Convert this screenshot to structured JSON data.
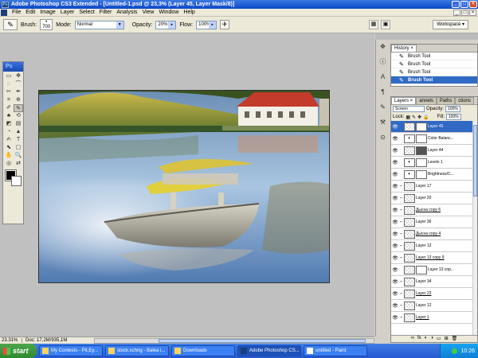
{
  "window": {
    "title": "Adobe Photoshop CS3 Extended - [Untitled-1.psd @ 23,3% (Layer 45, Layer Mask/8)]",
    "buttons": [
      "_",
      "□",
      "×"
    ]
  },
  "menu": [
    "File",
    "Edit",
    "Image",
    "Layer",
    "Select",
    "Filter",
    "Analysis",
    "View",
    "Window",
    "Help"
  ],
  "options": {
    "brush_label": "Brush:",
    "brush_size": "700",
    "mode_label": "Mode:",
    "mode_value": "Normal",
    "opacity_label": "Opacity:",
    "opacity_value": "20%",
    "flow_label": "Flow:",
    "flow_value": "100%",
    "workspace_label": "Workspace ▾"
  },
  "toolbox": {
    "title": "Ps",
    "tools": [
      "▭",
      "✥",
      "◌",
      "⌒",
      "✂",
      "✒",
      "⌗",
      "⊕",
      "✐",
      "✎",
      "♣",
      "⟲",
      "◩",
      "▤",
      "◔",
      "▲",
      "✍",
      "T",
      "⬉",
      "▢",
      "✋",
      "🔍",
      "◎",
      "⇄"
    ]
  },
  "history": {
    "tab": "History",
    "close": "×",
    "items": [
      "Brush Tool",
      "Brush Tool",
      "Brush Tool",
      "Brush Tool"
    ],
    "selected_index": 3
  },
  "layers": {
    "tabs": [
      "Layers ×",
      "annels",
      "Paths",
      "ctions"
    ],
    "blend_mode": "Screen",
    "opacity_label": "Opacity:",
    "opacity": "100%",
    "lock_label": "Lock:",
    "fill_label": "Fill:",
    "fill": "100%",
    "rows": [
      {
        "name": "Layer 45",
        "kind": "mask",
        "selected": true
      },
      {
        "name": "Color Balanc...",
        "kind": "adj",
        "selected": false
      },
      {
        "name": "Layer 44",
        "kind": "maskdark",
        "selected": false
      },
      {
        "name": "Levels 1",
        "kind": "adj",
        "selected": false
      },
      {
        "name": "Brightness/C...",
        "kind": "adj",
        "selected": false
      },
      {
        "name": "Layer 17",
        "kind": "plain",
        "selected": false
      },
      {
        "name": "Layer 20",
        "kind": "plain",
        "selected": false
      },
      {
        "name": "Дысна copy 6",
        "kind": "plain",
        "selected": false,
        "underline": true
      },
      {
        "name": "Layer 36",
        "kind": "plain",
        "selected": false
      },
      {
        "name": "Дысна copy 4",
        "kind": "plain",
        "selected": false,
        "underline": true
      },
      {
        "name": "Layer 13",
        "kind": "plain",
        "selected": false
      },
      {
        "name": "Layer 13 copy 9",
        "kind": "plain",
        "selected": false,
        "underline": true
      },
      {
        "name": "Layer 13 cop...",
        "kind": "mask",
        "selected": false
      },
      {
        "name": "Layer 34",
        "kind": "plain",
        "selected": false
      },
      {
        "name": "Layer 23",
        "kind": "plain",
        "selected": false,
        "underline": true
      },
      {
        "name": "Layer 12",
        "kind": "plain",
        "selected": false
      },
      {
        "name": "Layer 1",
        "kind": "plain",
        "selected": false,
        "underline": true
      }
    ],
    "footer_icons": [
      "∞",
      "fx",
      "◐",
      "◑",
      "▭",
      "⊞",
      "🗑"
    ]
  },
  "status": {
    "zoom": "23.31%",
    "doc": "Doc: 17,2M/935,1M"
  },
  "taskbar": {
    "start": "start",
    "tasks": [
      {
        "label": "My Contests - Pit,Ey...",
        "active": false
      },
      {
        "label": "stock.xchng - Balea i...",
        "active": false
      },
      {
        "label": "Downloads",
        "active": false
      },
      {
        "label": "Adobe Photoshop CS...",
        "active": true
      },
      {
        "label": "untitled - Paint",
        "active": false
      }
    ],
    "clock": "10:26"
  },
  "colors": {
    "selection": "#316ac5",
    "titlebar": "#0a48c7"
  }
}
